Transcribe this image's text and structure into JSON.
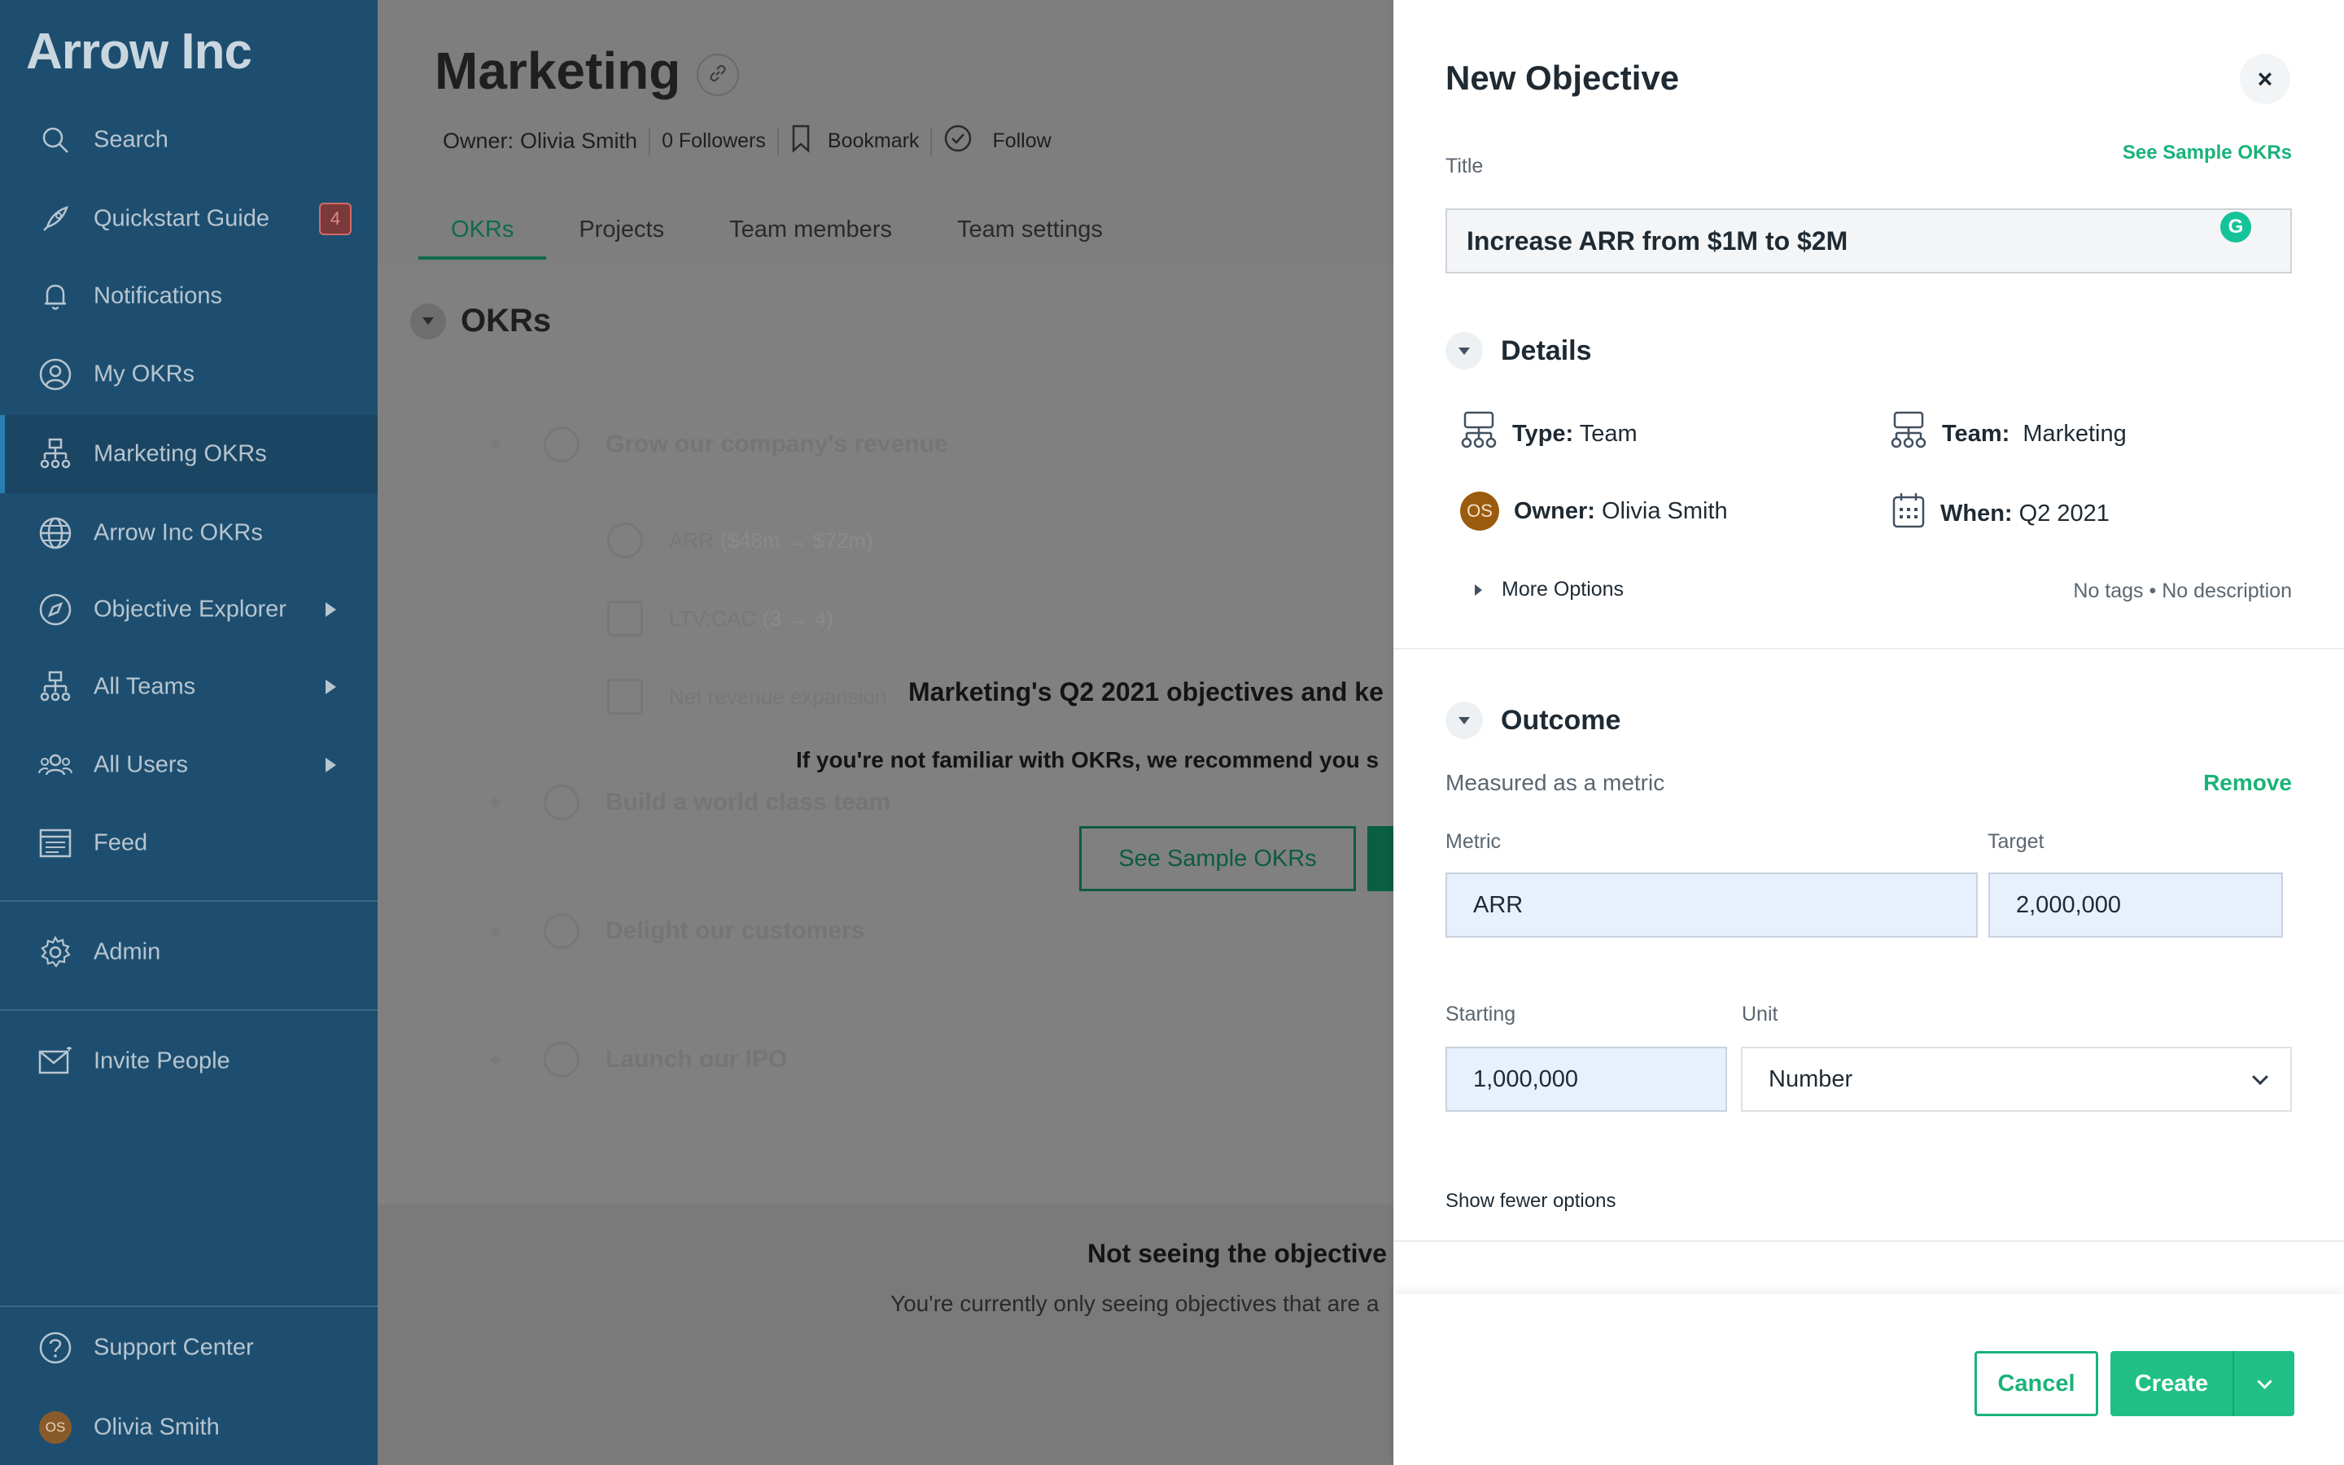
{
  "sidebar": {
    "logo": "Arrow Inc",
    "items": [
      {
        "label": "Search",
        "icon": "search-icon"
      },
      {
        "label": "Quickstart Guide",
        "icon": "rocket-icon",
        "badge": "4"
      },
      {
        "label": "Notifications",
        "icon": "bell-icon"
      },
      {
        "label": "My OKRs",
        "icon": "user-circle-icon"
      },
      {
        "label": "Marketing OKRs",
        "icon": "org-chart-icon",
        "active": true
      },
      {
        "label": "Arrow Inc OKRs",
        "icon": "globe-icon"
      },
      {
        "label": "Objective Explorer",
        "icon": "compass-icon",
        "expandable": true
      },
      {
        "label": "All Teams",
        "icon": "org-chart-icon",
        "expandable": true
      },
      {
        "label": "All Users",
        "icon": "users-icon",
        "expandable": true
      },
      {
        "label": "Feed",
        "icon": "feed-icon"
      },
      {
        "label": "Admin",
        "icon": "gear-icon"
      },
      {
        "label": "Invite People",
        "icon": "envelope-icon"
      },
      {
        "label": "Support Center",
        "icon": "help-icon"
      },
      {
        "label": "Olivia Smith",
        "avatar": "OS"
      }
    ]
  },
  "main": {
    "title": "Marketing",
    "owner_label": "Owner:",
    "owner_name": "Olivia Smith",
    "followers": "0 Followers",
    "bookmark": "Bookmark",
    "follow": "Follow",
    "tabs": [
      "OKRs",
      "Projects",
      "Team members",
      "Team settings"
    ],
    "section_title": "OKRs",
    "ghost_objectives": [
      "Grow our company's revenue",
      "Build a world class team",
      "Delight our customers",
      "Launch our IPO"
    ],
    "ghost_key_results": [
      {
        "label": "ARR",
        "detail": "($48m → $72m)"
      },
      {
        "label": "LTV:CAC",
        "detail": "(3 → 4)"
      },
      {
        "label": "Net revenue expansion",
        "detail": ""
      }
    ],
    "empty_heading": "Marketing's Q2 2021 objectives and ke",
    "empty_sub": "If you're not familiar with OKRs, we recommend you s",
    "see_sample_btn": "See Sample OKRs",
    "not_seeing": "Not seeing the objective",
    "currently_seeing": "You're currently only seeing objectives that are a"
  },
  "panel": {
    "title": "New Objective",
    "title_label": "Title",
    "see_sample_link": "See Sample OKRs",
    "title_value": "Increase ARR from $1M to $2M",
    "details_heading": "Details",
    "type_key": "Type:",
    "type_value": "Team",
    "team_key": "Team:",
    "team_value": "Marketing",
    "owner_avatar": "OS",
    "owner_key": "Owner:",
    "owner_value": "Olivia Smith",
    "when_key": "When:",
    "when_value": "Q2 2021",
    "more_options": "More Options",
    "tags_summary": "No tags • No description",
    "outcome_heading": "Outcome",
    "measured_as": "Measured as a metric",
    "remove": "Remove",
    "metric_label": "Metric",
    "metric_value": "ARR",
    "target_label": "Target",
    "target_value": "2,000,000",
    "starting_label": "Starting",
    "starting_value": "1,000,000",
    "unit_label": "Unit",
    "unit_value": "Number",
    "show_fewer": "Show fewer options",
    "cancel": "Cancel",
    "create": "Create"
  },
  "colors": {
    "sidebar_bg": "#1d4e70",
    "accent_green": "#1fbf85",
    "input_blue": "#e7f0fd"
  }
}
